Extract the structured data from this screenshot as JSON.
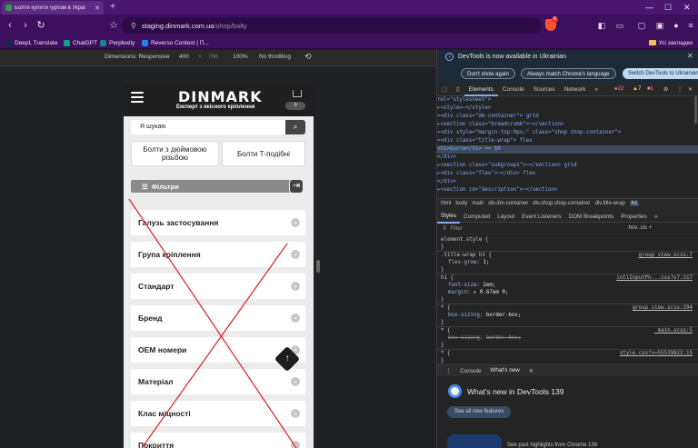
{
  "browser": {
    "tab_title": "Болти купити гуртом в Украї",
    "new_tab": "+",
    "minimize": "—",
    "maximize": "☐",
    "close": "✕",
    "nav": {
      "back": "‹",
      "forward": "›",
      "reload": "↻",
      "bookmark": "☆"
    },
    "url_host": "staging.dinmark.com.ua",
    "url_path": "/shop/bolty",
    "shield_count": "6",
    "bookmarks": [
      {
        "label": "DeepL Translate",
        "color": "#0f2b46"
      },
      {
        "label": "ChatGPT",
        "color": "#10a37f"
      },
      {
        "label": "Perplexity",
        "color": "#20808d"
      },
      {
        "label": "Reverso Context | П...",
        "color": "#1e88e5"
      }
    ],
    "all_bookmarks": "Усі закладки"
  },
  "device_toolbar": {
    "dimensions_label": "Dimensions: Responsive",
    "width": "400",
    "times": "×",
    "height_placeholder": "788",
    "zoom": "100%",
    "throttling": "No throttling"
  },
  "page": {
    "logo": "DINMARK",
    "tagline": "Експерт з якісного кріплення",
    "cart_count": "0",
    "search_placeholder": "Я шукаю",
    "categories": [
      "Болти з дюймовою різьбою",
      "Болти Т-подібні"
    ],
    "filters_label": "Фільтри",
    "filter_items": [
      "Галузь застосування",
      "Група кріплення",
      "Стандарт",
      "Бренд",
      "OEM номери",
      "Матеріал",
      "Клас міцності",
      "Покриття"
    ]
  },
  "devtools": {
    "info_text": "DevTools is now available in Ukrainian",
    "info_buttons": [
      "Don't show again",
      "Always match Chrome's language",
      "Switch DevTools to Ukrainian"
    ],
    "tabs": [
      "Elements",
      "Console",
      "Sources",
      "Network",
      "»"
    ],
    "errors": "22",
    "warnings": "7",
    "issues": "1",
    "dom_lines": [
      {
        "pre": "  ",
        "html": "rel=\"stylesheet\">"
      },
      {
        "pre": " ▸",
        "html": "<style>⋯</style>"
      },
      {
        "pre": " ▾",
        "html": "<div class=\"dm-container\"> grid"
      },
      {
        "pre": "   ▸",
        "html": "<section class=\"breadcrumb\">⋯</section>"
      },
      {
        "pre": "   ▾",
        "html": "<div style=\"margin-top:0px;\" class=\"shop shop-container\">"
      },
      {
        "pre": "     ▾",
        "html": "<div class=\"title-wrap\"> flex"
      },
      {
        "pre": "        ",
        "html": "<h1>Болти</h1> == $0"
      },
      {
        "pre": "      ",
        "html": "</div>"
      },
      {
        "pre": "     ▸",
        "html": "<section class=\"subgroups\">⋯</section> grid"
      },
      {
        "pre": "     ▸",
        "html": "<div class=\"flex\">⋯</div> flex"
      },
      {
        "pre": "    ",
        "html": "</div>"
      },
      {
        "pre": "   ▸",
        "html": "<section id=\"description\">⋯</section>"
      }
    ],
    "breadcrumbs": [
      "html",
      "body",
      "main",
      "div.dm-container",
      "div.shop.shop-container",
      "div.title-wrap",
      "h1"
    ],
    "style_tabs": [
      "Styles",
      "Computed",
      "Layout",
      "Event Listeners",
      "DOM Breakpoints",
      "Properties",
      "»"
    ],
    "filter_placeholder": "Filter",
    "filter_right": ":hov .cls +",
    "rules": [
      {
        "selector": "element.style {",
        "decls": [],
        "source": ""
      },
      {
        "selector": ".title-wrap h1 {",
        "decls": [
          [
            "flex-grow",
            "1;"
          ]
        ],
        "source": "group_view.scss:7"
      },
      {
        "selector": "h1 {",
        "decls": [
          [
            "font-size",
            "2em;"
          ],
          [
            "margin",
            "▸ 0.67em 0;"
          ]
        ],
        "source": "intlInputPh...css?v7:317"
      },
      {
        "selector": "* {",
        "decls": [
          [
            "box-sizing",
            "border-box;"
          ]
        ],
        "source": "group_view.scss:294"
      },
      {
        "selector": "* {",
        "decls": [
          [
            "box-sizing",
            "border-box;"
          ]
        ],
        "source": "_main.scss:5"
      },
      {
        "selector": "* {",
        "decls": [],
        "source": "style.css?v=55539822:15"
      }
    ],
    "drawer_tabs": [
      "Console",
      "What's new"
    ],
    "whats_new_title": "What's new in DevTools 139",
    "see_all": "See all new features",
    "card_text": "See past highlights from Chrome 138"
  }
}
